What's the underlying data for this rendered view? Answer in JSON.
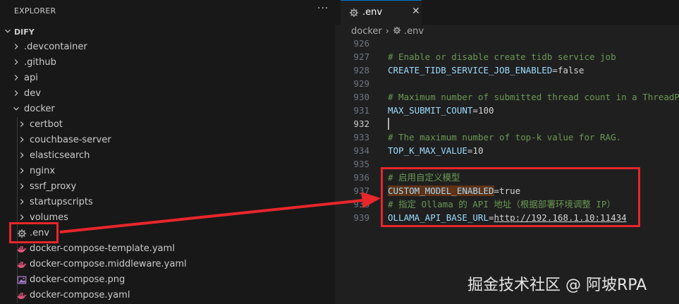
{
  "explorer": {
    "title": "EXPLORER",
    "more_actions": "···",
    "root": "DIFY",
    "items": [
      {
        "label": ".devcontainer"
      },
      {
        "label": ".github"
      },
      {
        "label": "api"
      },
      {
        "label": "dev"
      },
      {
        "label": "docker"
      },
      {
        "label": "certbot"
      },
      {
        "label": "couchbase-server"
      },
      {
        "label": "elasticsearch"
      },
      {
        "label": "nginx"
      },
      {
        "label": "ssrf_proxy"
      },
      {
        "label": "startupscripts"
      },
      {
        "label": "volumes"
      },
      {
        "label": ".env"
      },
      {
        "label": "docker-compose-template.yaml"
      },
      {
        "label": "docker-compose.middleware.yaml"
      },
      {
        "label": "docker-compose.png"
      },
      {
        "label": "docker-compose.yaml"
      }
    ]
  },
  "editor": {
    "tab_label": ".env",
    "tab_close": "✕",
    "breadcrumb": {
      "folder": "docker",
      "sep": "›",
      "file": ".env"
    },
    "lines": [
      {
        "num": "926",
        "key": "",
        "op": "",
        "val": "",
        "comment": ""
      },
      {
        "num": "927",
        "comment": "# Enable or disable create tidb service job"
      },
      {
        "num": "928",
        "key": "CREATE_TIDB_SERVICE_JOB_ENABLED",
        "op": "=",
        "val": "false"
      },
      {
        "num": "929",
        "comment": ""
      },
      {
        "num": "930",
        "comment": "# Maximum number of submitted thread count in a ThreadPool"
      },
      {
        "num": "931",
        "key": "MAX_SUBMIT_COUNT",
        "op": "=",
        "val": "100"
      },
      {
        "num": "932",
        "comment": ""
      },
      {
        "num": "933",
        "comment": "# The maximum number of top-k value for RAG."
      },
      {
        "num": "934",
        "key": "TOP_K_MAX_VALUE",
        "op": "=",
        "val": "10"
      },
      {
        "num": "935",
        "comment": ""
      },
      {
        "num": "936",
        "comment": "# 启用自定义模型"
      },
      {
        "num": "937",
        "key": "CUSTOM_MODEL_ENABLED",
        "op": "=",
        "val": "true"
      },
      {
        "num": "938",
        "comment": "# 指定 Ollama 的 API 地址（根据部署环境调整 IP）"
      },
      {
        "num": "939",
        "key": "OLLAMA_API_BASE_URL",
        "op": "=",
        "val": "http://192.168.1.10:11434"
      }
    ]
  },
  "watermark": "掘金技术社区 @ 阿坡RPA",
  "colors": {
    "annotation_red": "#e8262b",
    "accent": "#0078d4"
  }
}
